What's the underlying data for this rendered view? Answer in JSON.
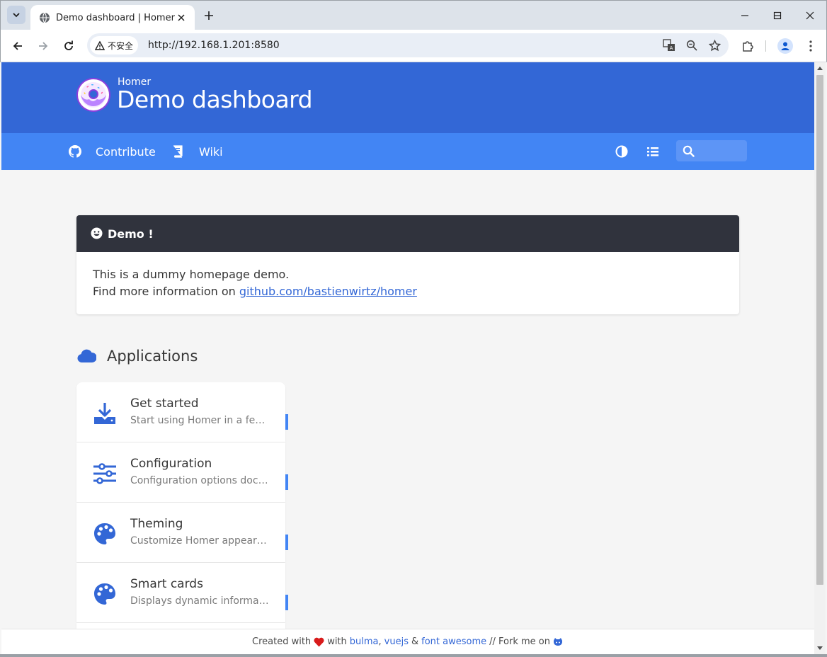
{
  "browser": {
    "tab_title": "Demo dashboard | Homer",
    "security_label": "不安全",
    "url": "http://192.168.1.201:8580"
  },
  "header": {
    "subtitle": "Homer",
    "title": "Demo dashboard"
  },
  "navbar": {
    "links": [
      {
        "label": "Contribute",
        "icon": "github-icon"
      },
      {
        "label": "Wiki",
        "icon": "book-icon"
      }
    ],
    "search_placeholder": ""
  },
  "message": {
    "title": "Demo !",
    "line1": "This is a dummy homepage demo.",
    "line2_prefix": "Find more information on ",
    "link_text": "github.com/bastienwirtz/homer"
  },
  "group": {
    "name": "Applications",
    "icon": "cloud-icon",
    "items": [
      {
        "name": "Get started",
        "subtitle": "Start using Homer in a few minutes",
        "icon": "download-icon"
      },
      {
        "name": "Configuration",
        "subtitle": "Configuration options documentation",
        "icon": "sliders-icon"
      },
      {
        "name": "Theming",
        "subtitle": "Customize Homer appearance",
        "icon": "palette-icon"
      },
      {
        "name": "Smart cards",
        "subtitle": "Displays dynamic information",
        "icon": "palette-icon"
      }
    ]
  },
  "footer": {
    "created_with": "Created with",
    "with": "with",
    "bulma": "bulma",
    "comma": ",",
    "vuejs": "vuejs",
    "amp": "&",
    "fontawesome": "font awesome",
    "fork": "// Fork me on"
  },
  "colors": {
    "hero": "#3367d6",
    "navbar": "#4285f4",
    "message_header": "#30333d",
    "accent": "#3367d6"
  }
}
